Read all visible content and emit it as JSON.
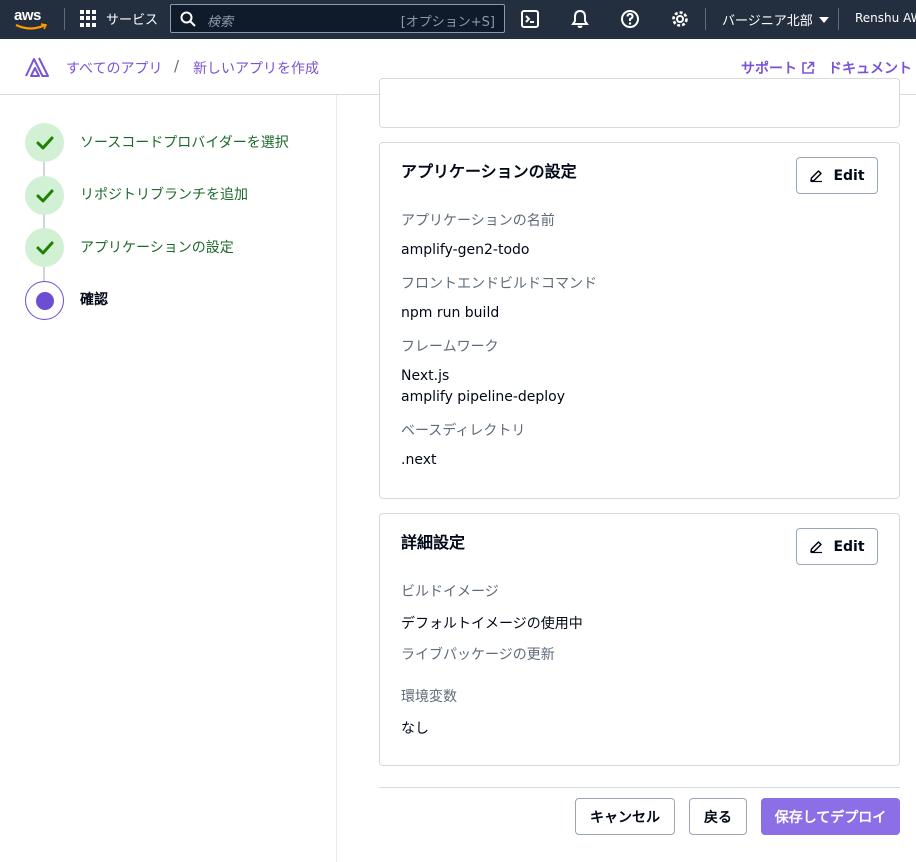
{
  "topnav": {
    "logo_text": "aws",
    "services_label": "サービス",
    "search_placeholder": "検索",
    "search_shortcut": "[オプション+S]",
    "region_label": "バージニア北部",
    "account_label": "Renshu AWS"
  },
  "header": {
    "breadcrumb_1": "すべてのアプリ",
    "breadcrumb_sep": "/",
    "breadcrumb_2": "新しいアプリを作成",
    "support_label": "サポート",
    "docs_label": "ドキュメント"
  },
  "steps": [
    {
      "label": "ソースコードプロバイダーを選択",
      "state": "done"
    },
    {
      "label": "リポジトリブランチを追加",
      "state": "done"
    },
    {
      "label": "アプリケーションの設定",
      "state": "done"
    },
    {
      "label": "確認",
      "state": "active"
    }
  ],
  "app_settings": {
    "title": "アプリケーションの設定",
    "edit_label": "Edit",
    "name_key": "アプリケーションの名前",
    "name_val": "amplify-gen2-todo",
    "build_cmd_key": "フロントエンドビルドコマンド",
    "build_cmd_val": "npm run build",
    "framework_key": "フレームワーク",
    "framework_val_1": "Next.js",
    "framework_val_2": "amplify pipeline-deploy",
    "basedir_key": "ベースディレクトリ",
    "basedir_val": ".next"
  },
  "advanced": {
    "title": "詳細設定",
    "edit_label": "Edit",
    "image_key": "ビルドイメージ",
    "image_val": "デフォルトイメージの使用中",
    "live_pkg_key": "ライブパッケージの更新",
    "env_key": "環境変数",
    "env_val": "なし"
  },
  "footer": {
    "cancel_label": "キャンセル",
    "back_label": "戻る",
    "deploy_label": "保存してデプロイ"
  },
  "colors": {
    "nav_bg": "#232f3e",
    "accent": "#7b53d6",
    "primary_button": "#8c6ee6",
    "step_done_bg": "#d1f0d4",
    "step_done_check": "#1d8102"
  }
}
